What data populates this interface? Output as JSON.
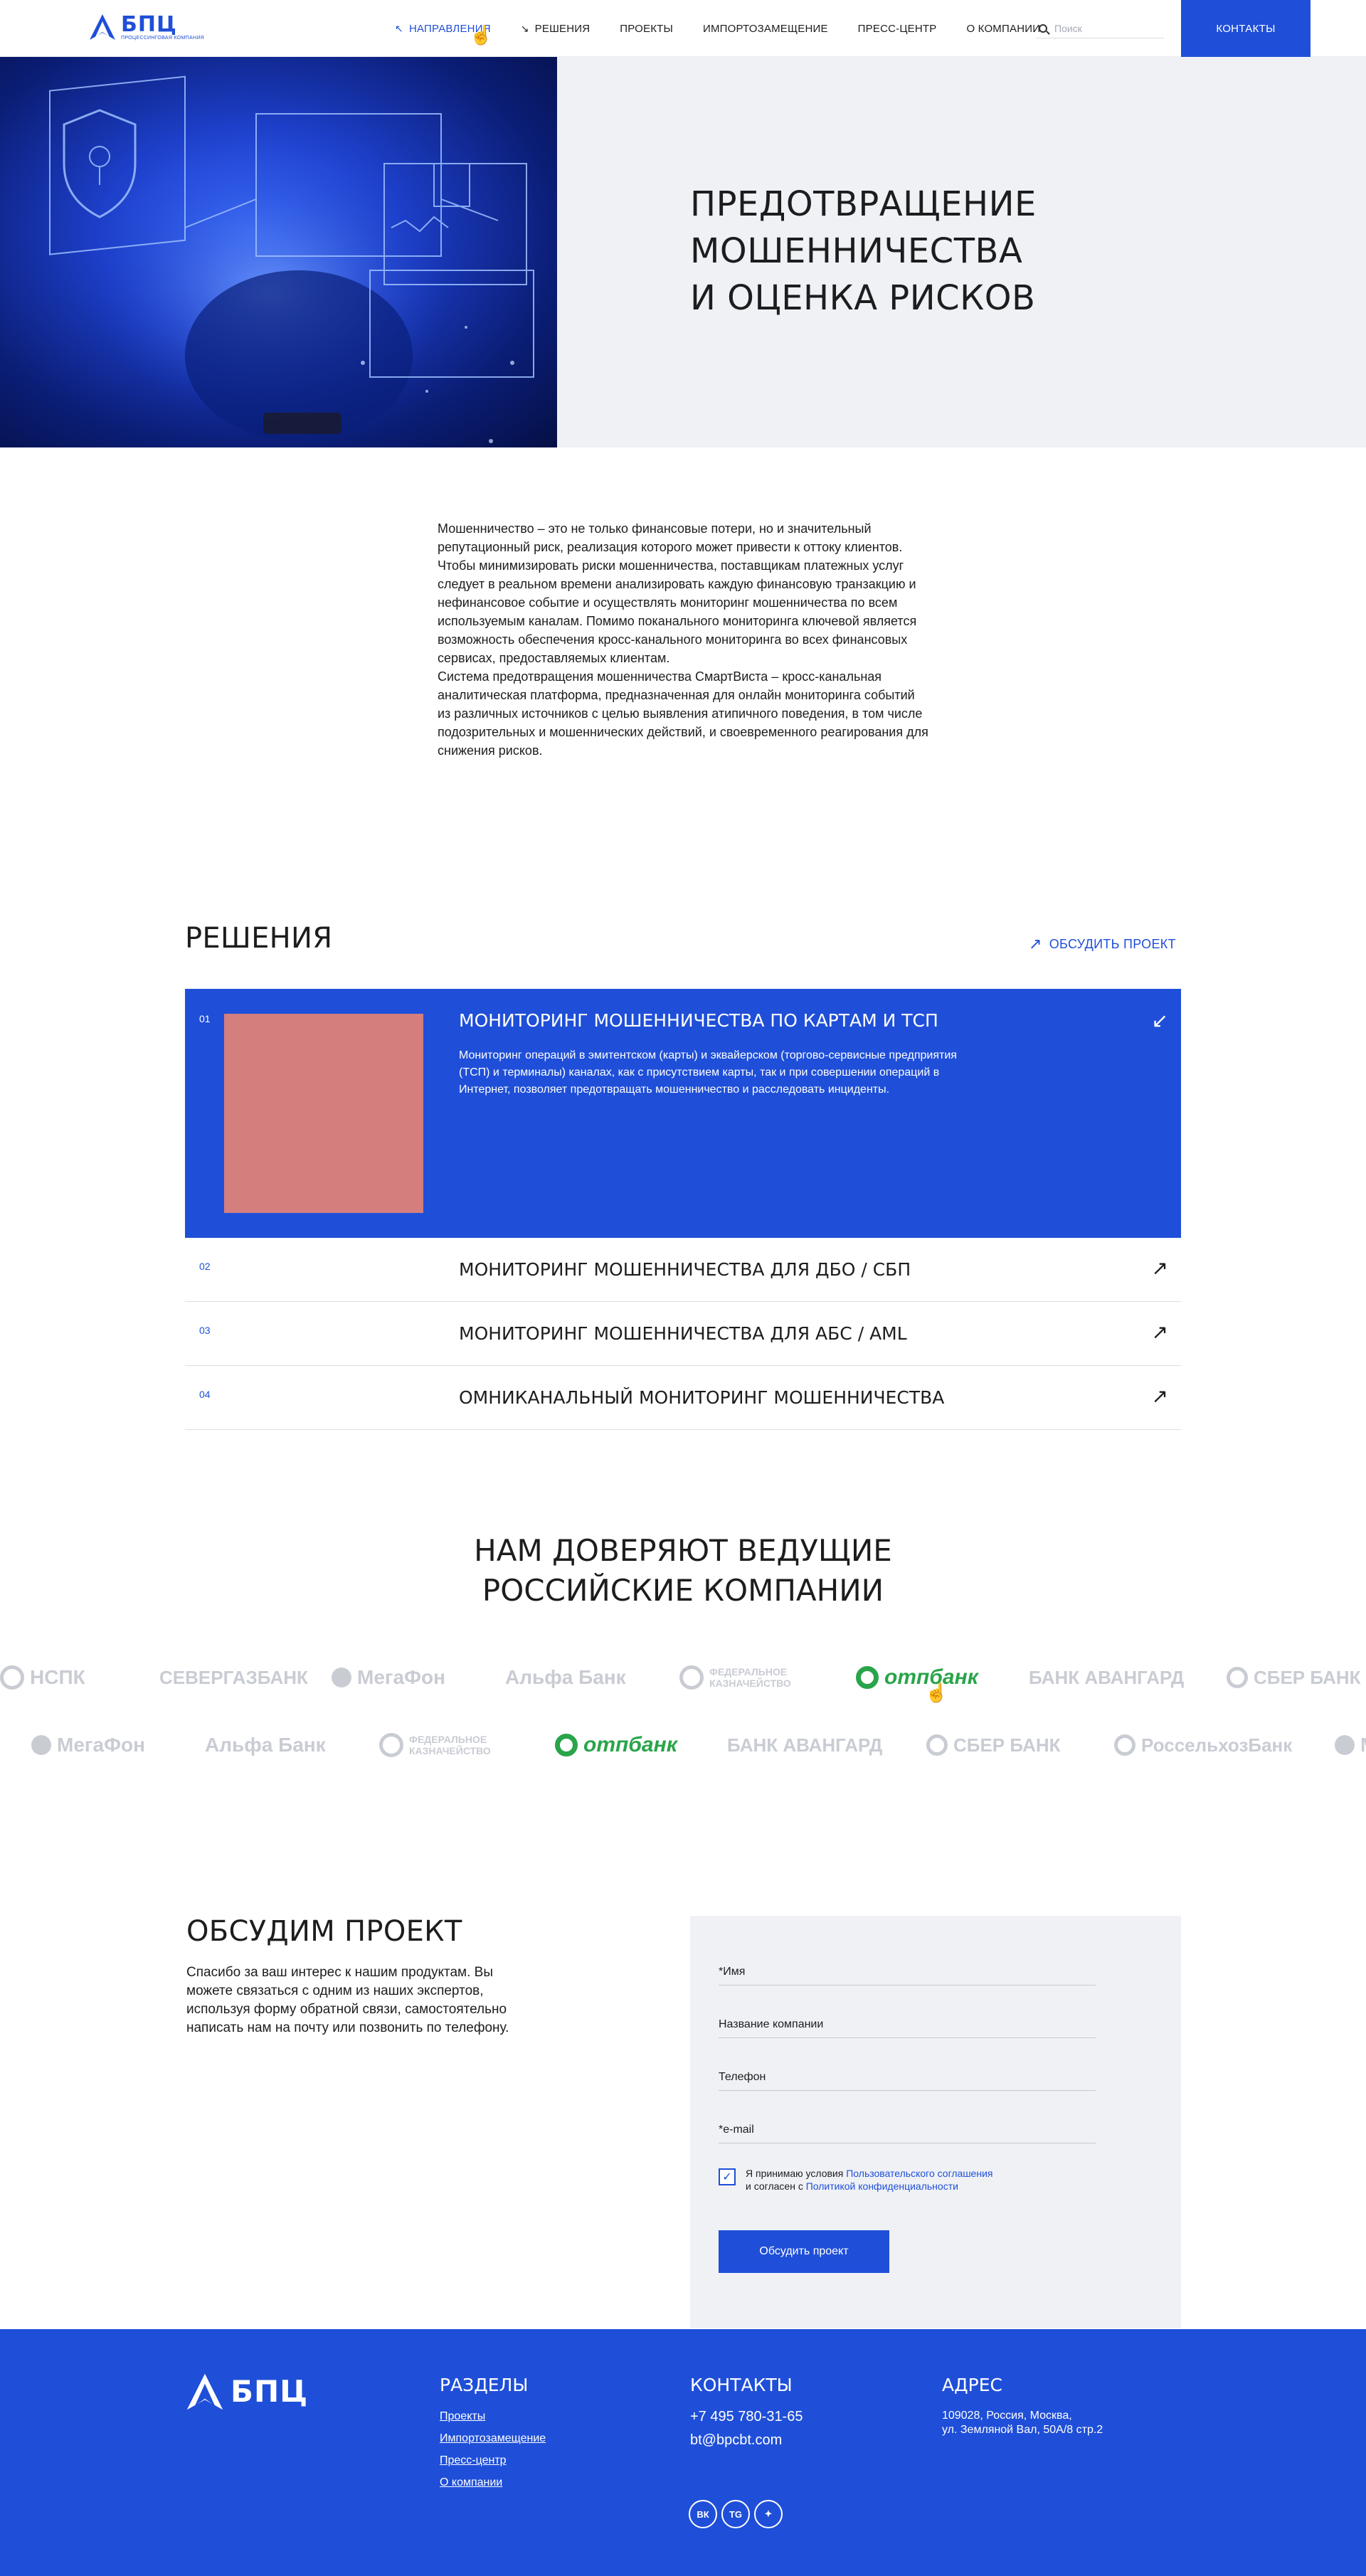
{
  "header": {
    "logo_name": "БПЦ",
    "logo_sub": "ПРОЦЕССИНГОВАЯ КОМПАНИЯ",
    "nav": [
      {
        "label": "Направления",
        "arrow": "↖"
      },
      {
        "label": "Решения",
        "arrow": "↘"
      },
      {
        "label": "Проекты"
      },
      {
        "label": "Импортозамещение"
      },
      {
        "label": "Пресс-центр"
      },
      {
        "label": "О компании"
      }
    ],
    "search_placeholder": "Поиск",
    "contacts_label": "Контакты"
  },
  "hero": {
    "title_lines": [
      "Предотвращение",
      "мошенничества",
      "и оценка рисков"
    ]
  },
  "intro": {
    "paragraphs": [
      "Мошенничество – это не только финансовые потери, но и значительный репутационный риск, реализация которого может привести к оттоку клиентов. Чтобы минимизировать риски мошенничества, поставщикам платежных услуг следует в реальном времени анализировать каждую финансовую транзакцию и нефинансовое событие и осуществлять мониторинг мошенничества по всем используемым каналам. Помимо поканального мониторинга ключевой является возможность обеспечения кросс-канального мониторинга во всех финансовых сервисах, предоставляемых клиентам.",
      "Система предотвращения мошенничества СмартВиста – кросс-канальная аналитическая платформа, предназначенная для онлайн мониторинга событий из различных источников с целью выявления атипичного поведения, в том числе подозрительных и мошеннических действий, и своевременного реагирования для снижения рисков."
    ]
  },
  "solutions": {
    "title": "Решения",
    "discuss_link": "Обсудить проект",
    "items": [
      {
        "num": "01",
        "title": "Мониторинг мошенничества по картам и ТСП",
        "desc": "Мониторинг операций в эмитентском (карты) и эквайерском (торгово-сервисные предприятия (ТСП) и терминалы) каналах, как с присутствием карты, так и при совершении операций в Интернет, позволяет предотвращать мошенничество и расследовать инциденты.",
        "arrow": "↙"
      },
      {
        "num": "02",
        "title": "Мониторинг мошенничества для ДБО / СБП",
        "arrow": "↗"
      },
      {
        "num": "03",
        "title": "Мониторинг мошенничества для АБС / AML",
        "arrow": "↗"
      },
      {
        "num": "04",
        "title": "Омниканальный мониторинг мошенничества",
        "arrow": "↗"
      }
    ]
  },
  "trust": {
    "title_lines": [
      "Нам доверяют ведущие",
      "российские компании"
    ],
    "row1": [
      "НСПК",
      "СЕВЕРГАЗБАНК",
      "МегаФон",
      "Альфа Банк",
      "ФЕДЕРАЛЬНОЕ КАЗНАЧЕЙСТВО",
      "отпбанк",
      "БАНК АВАНГАРД",
      "СБЕР БАНК"
    ],
    "row2": [
      "МегаФон",
      "Альфа Банк",
      "ФЕДЕРАЛЬНОЕ КАЗНАЧЕЙСТВО",
      "отпбанк",
      "БАНК АВАНГАРД",
      "СБЕР БАНК",
      "РоссельхозБанк",
      "М"
    ]
  },
  "discuss": {
    "title": "Обсудим проект",
    "text": "Спасибо за ваш интерес к нашим продуктам. Вы можете связаться с одним из наших экспертов, используя форму обратной связи, самостоятельно написать нам на почту или позвонить по телефону.",
    "fields": [
      "*Имя",
      "Название компании",
      "Телефон",
      "*e-mail"
    ],
    "agree_prefix": "Я принимаю условия ",
    "agree_link1": "Пользовательского соглашения",
    "agree_mid": "и согласен с ",
    "agree_link2": "Политикой конфиденциальности",
    "submit": "Обсудить проект"
  },
  "footer": {
    "logo_name": "БПЦ",
    "sections_title": "Разделы",
    "sections": [
      "Проекты",
      "Импортозамещение",
      "Пресс-центр",
      "О компании"
    ],
    "contacts_title": "Контакты",
    "phone": "+7 495 780-31-65",
    "email": "bt@bpcbt.com",
    "address_title": "Адрес",
    "address_line1": "109028, Россия, Москва,",
    "address_line2": "ул. Земляной Вал, 50А/8 стр.2",
    "social": [
      "ВК",
      "TG",
      "✦"
    ]
  },
  "colors": {
    "accent": "#1f4fd8",
    "panel": "#eff1f5",
    "placeholder_block": "#d47e7e"
  }
}
